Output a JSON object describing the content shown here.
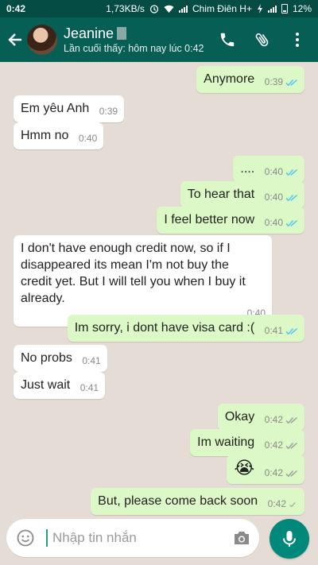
{
  "status_bar": {
    "time": "0:42",
    "speed": "1,73KB/s",
    "carrier": "Chim Điên H+",
    "battery": "12%"
  },
  "header": {
    "contact_name": "Jeanine",
    "last_seen": "Lần cuối thấy: hôm nay lúc 0:42"
  },
  "messages": [
    {
      "dir": "out",
      "text": "Anymore",
      "time": "0:39",
      "status": "read"
    },
    {
      "dir": "in",
      "text": "Em yêu Anh",
      "time": "0:39"
    },
    {
      "dir": "in",
      "text": "Hmm no",
      "time": "0:40"
    },
    {
      "dir": "out",
      "text": "....",
      "time": "0:40",
      "status": "read"
    },
    {
      "dir": "out",
      "text": "To hear that",
      "time": "0:40",
      "status": "read"
    },
    {
      "dir": "out",
      "text": "I feel better now",
      "time": "0:40",
      "status": "read"
    },
    {
      "dir": "in",
      "text": "I don't have enough credit now, so if I\ndisappeared its mean I'm not buy the\ncredit yet. But I will tell you when I buy it\nalready.",
      "time": "0:40"
    },
    {
      "dir": "out",
      "text": "Im sorry, i dont have visa card :(",
      "time": "0:41",
      "status": "read"
    },
    {
      "dir": "in",
      "text": "No probs",
      "time": "0:41"
    },
    {
      "dir": "in",
      "text": "Just wait",
      "time": "0:41"
    },
    {
      "dir": "out",
      "text": "Okay",
      "time": "0:42",
      "status": "delivered"
    },
    {
      "dir": "out",
      "text": "Im waiting",
      "time": "0:42",
      "status": "delivered"
    },
    {
      "dir": "out",
      "text": "",
      "emoji": "😭",
      "time": "0:42",
      "status": "delivered"
    },
    {
      "dir": "out",
      "text": "But, please come back soon",
      "time": "0:42",
      "status": "sent"
    }
  ],
  "composer": {
    "placeholder": "Nhập tin nhắn"
  },
  "icons": {
    "back": "arrow-back-icon",
    "call": "phone-icon",
    "attach": "paperclip-icon",
    "menu": "more-vert-icon",
    "emoji": "emoji-icon",
    "camera": "camera-icon",
    "mic": "mic-icon"
  },
  "colors": {
    "toolbar": "#075e54",
    "status_bar": "#054d44",
    "chat_bg": "#e5ddd5",
    "outgoing": "#dcf8c6",
    "incoming": "#ffffff",
    "read_tick": "#4fc3f7",
    "accent": "#00897b"
  }
}
